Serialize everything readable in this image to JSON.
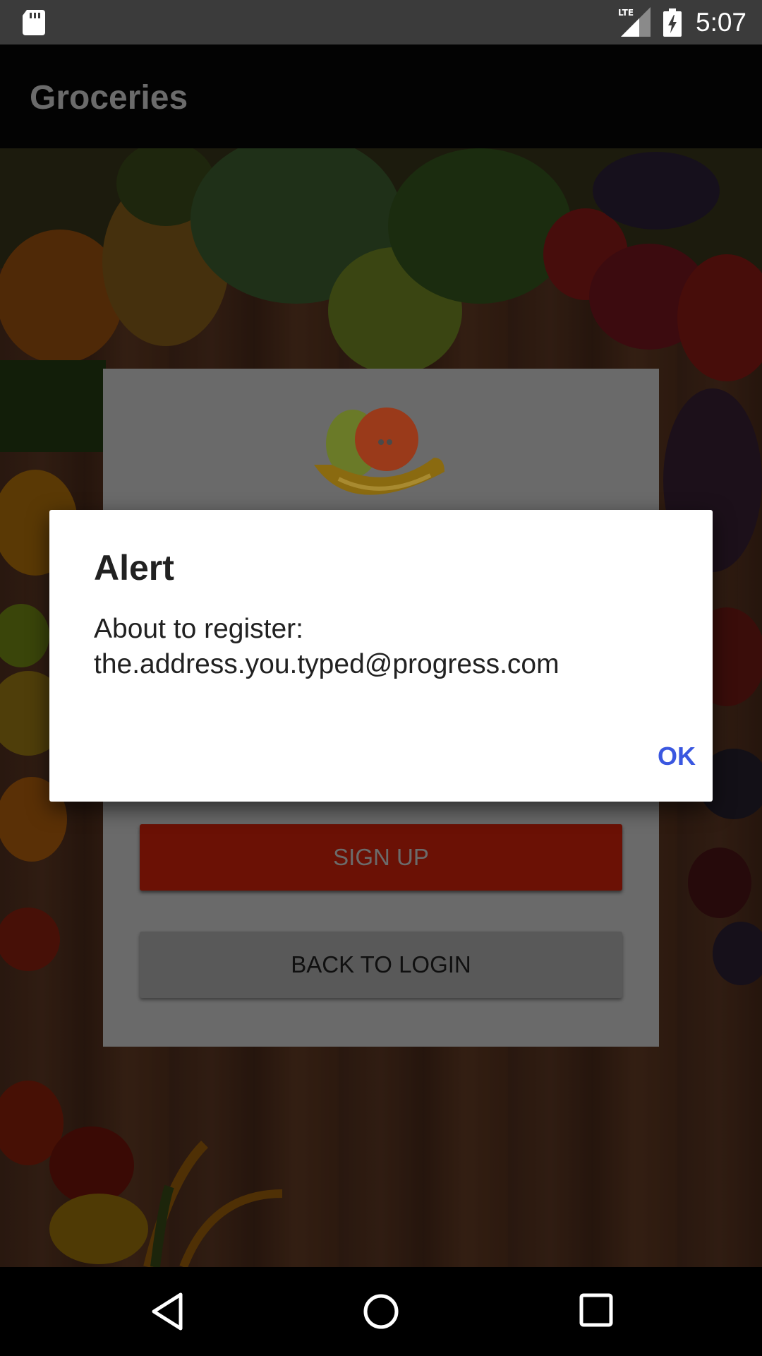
{
  "status_bar": {
    "time": "5:07",
    "icons": [
      "sd-card-icon",
      "lte-signal-icon",
      "battery-charging-icon"
    ],
    "network_label": "LTE"
  },
  "app_bar": {
    "title": "Groceries"
  },
  "register_card": {
    "signup_label": "SIGN UP",
    "back_label": "BACK TO LOGIN"
  },
  "dialog": {
    "title": "Alert",
    "message": "About to register:\nthe.address.you.typed@progress.com",
    "ok_label": "OK"
  },
  "nav_bar": {
    "icons": [
      "back-icon",
      "home-icon",
      "recents-icon"
    ]
  },
  "colors": {
    "accent": "#3a57e0",
    "signup": "#b51c09",
    "scrim": "rgba(0,0,0,0.6)"
  }
}
